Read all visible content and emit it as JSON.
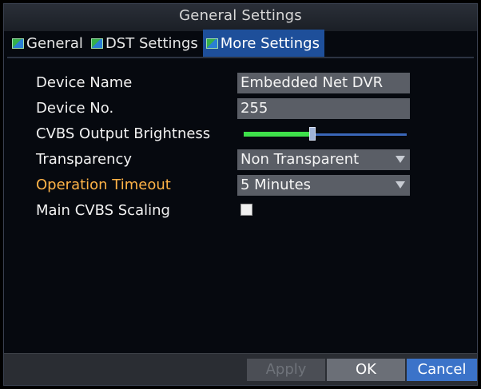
{
  "window": {
    "title": "General Settings"
  },
  "tabs": [
    {
      "label": "General"
    },
    {
      "label": "DST Settings"
    },
    {
      "label": "More Settings"
    }
  ],
  "settings": {
    "device_name": {
      "label": "Device Name",
      "value": "Embedded Net DVR"
    },
    "device_no": {
      "label": "Device No.",
      "value": "255"
    },
    "cvbs_brightness": {
      "label": "CVBS Output Brightness",
      "level": 0.42
    },
    "transparency": {
      "label": "Transparency",
      "value": "Non Transparent"
    },
    "operation_timeout": {
      "label": "Operation Timeout",
      "value": "5 Minutes"
    },
    "main_cvbs_scaling": {
      "label": "Main CVBS Scaling",
      "checked": false
    }
  },
  "footer": {
    "apply_label": "Apply",
    "ok_label": "OK",
    "cancel_label": "Cancel"
  },
  "colors": {
    "active_tab": "#1e4f9a",
    "accent_label": "#ffb347",
    "slider_fill": "#3ee04a",
    "cancel_button": "#3b73c9"
  }
}
